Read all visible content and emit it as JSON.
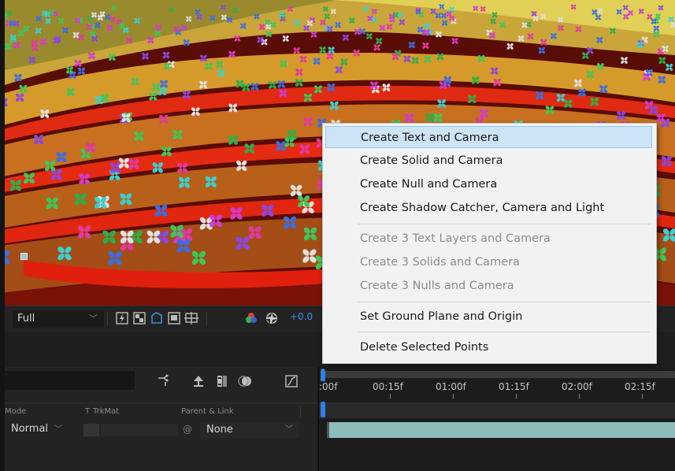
{
  "viewer": {
    "resolution": "Full",
    "exposure": "+0.0",
    "icons": [
      "fast-preview-icon",
      "transparency-grid-icon",
      "mask-path-visibility-icon",
      "region-of-interest-icon",
      "guides-icon",
      "color-channels-icon",
      "exposure-reset-icon"
    ]
  },
  "timeline": {
    "search": {
      "value": "",
      "placeholder": ""
    },
    "controls": [
      "comp-mini-flowchart-icon",
      "draft-3d-icon",
      "frame-blending-icon",
      "motion-blur-icon",
      "graph-editor-icon"
    ],
    "columns": {
      "mode": "Mode",
      "t": "T",
      "trkmat": "TrkMat",
      "parent": "Parent & Link"
    },
    "layer": {
      "mode": "Normal",
      "parent": "None"
    },
    "ruler": [
      ":00f",
      "00:15f",
      "01:00f",
      "01:15f",
      "02:00f",
      "02:15f"
    ]
  },
  "context_menu": {
    "items": [
      {
        "label": "Create Text and Camera",
        "enabled": true,
        "highlighted": true
      },
      {
        "label": "Create Solid and Camera",
        "enabled": true
      },
      {
        "label": "Create Null and Camera",
        "enabled": true
      },
      {
        "label": "Create Shadow Catcher, Camera and Light",
        "enabled": true
      },
      {
        "label": "Create 3 Text Layers and Camera",
        "enabled": false
      },
      {
        "label": "Create 3 Solids and Camera",
        "enabled": false
      },
      {
        "label": "Create 3 Nulls and Camera",
        "enabled": false
      },
      {
        "label": "Set Ground Plane and Origin",
        "enabled": true
      },
      {
        "label": "Delete Selected Points",
        "enabled": true
      }
    ]
  },
  "colors": {
    "accent": "#2f7fe0",
    "menu_highlight": "#cde4f7",
    "layer_bar": "#8cbdbb"
  }
}
